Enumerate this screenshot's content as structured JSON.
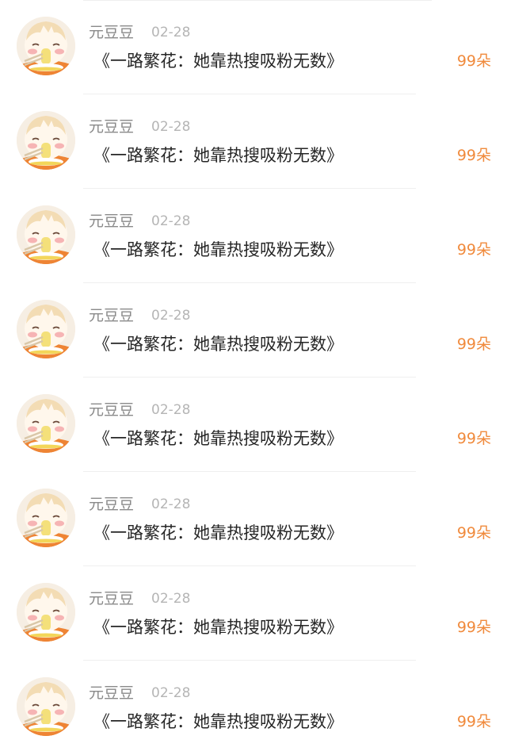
{
  "colors": {
    "accent_orange": "#f08a3c",
    "name_gray": "#8a8a8a",
    "date_gray": "#b5b5b5",
    "title_dark": "#262626"
  },
  "gifts": [
    {
      "user": "元豆豆",
      "date": "02-28",
      "title": "《一路繁花：她靠热搜吸粉无数》",
      "flowers": "99朵",
      "avatar_icon": "anime-girl-avatar-icon"
    },
    {
      "user": "元豆豆",
      "date": "02-28",
      "title": "《一路繁花：她靠热搜吸粉无数》",
      "flowers": "99朵",
      "avatar_icon": "anime-girl-avatar-icon"
    },
    {
      "user": "元豆豆",
      "date": "02-28",
      "title": "《一路繁花：她靠热搜吸粉无数》",
      "flowers": "99朵",
      "avatar_icon": "anime-girl-avatar-icon"
    },
    {
      "user": "元豆豆",
      "date": "02-28",
      "title": "《一路繁花：她靠热搜吸粉无数》",
      "flowers": "99朵",
      "avatar_icon": "anime-girl-avatar-icon"
    },
    {
      "user": "元豆豆",
      "date": "02-28",
      "title": "《一路繁花：她靠热搜吸粉无数》",
      "flowers": "99朵",
      "avatar_icon": "anime-girl-avatar-icon"
    },
    {
      "user": "元豆豆",
      "date": "02-28",
      "title": "《一路繁花：她靠热搜吸粉无数》",
      "flowers": "99朵",
      "avatar_icon": "anime-girl-avatar-icon"
    },
    {
      "user": "元豆豆",
      "date": "02-28",
      "title": "《一路繁花：她靠热搜吸粉无数》",
      "flowers": "99朵",
      "avatar_icon": "anime-girl-avatar-icon"
    },
    {
      "user": "元豆豆",
      "date": "02-28",
      "title": "《一路繁花：她靠热搜吸粉无数》",
      "flowers": "99朵",
      "avatar_icon": "anime-girl-avatar-icon"
    }
  ]
}
